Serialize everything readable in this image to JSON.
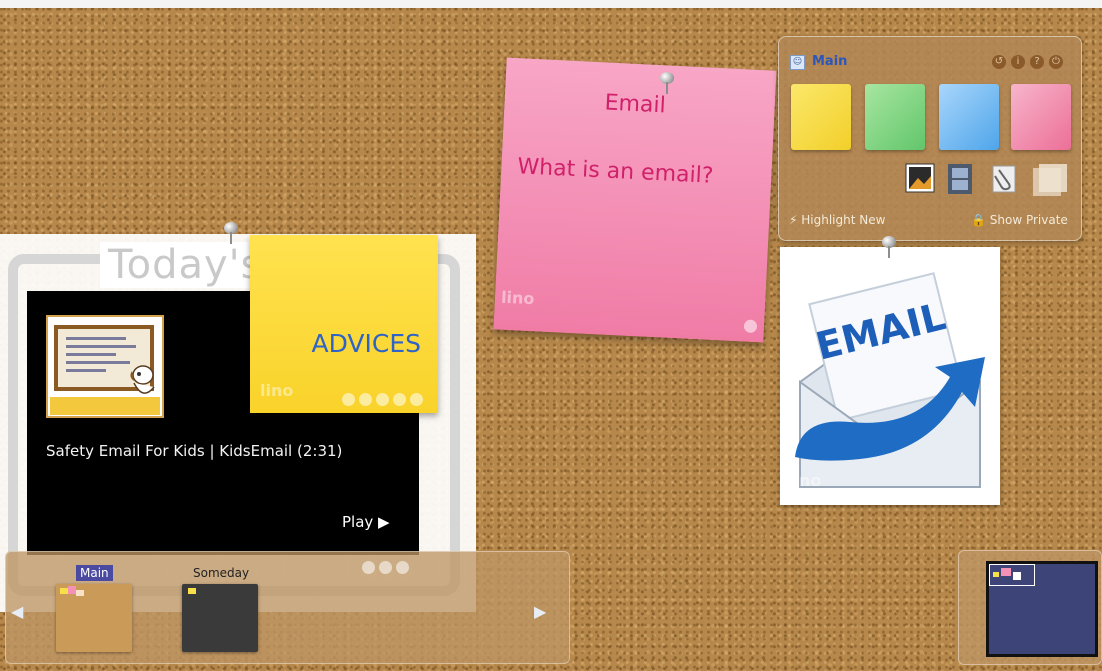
{
  "today_panel": {
    "title": "Today's"
  },
  "video": {
    "title": "Safety Email For Kids | KidsEmail (2:31)",
    "play_label": "Play ▶"
  },
  "notes": {
    "yellow": {
      "text": "ADVICES",
      "color": "#f9d32a"
    },
    "pink": {
      "title": "Email",
      "body": "What is an email?",
      "color": "#f391b6"
    },
    "watermark": "lino"
  },
  "main_panel": {
    "title": "Main",
    "swatch_colors": [
      "#f7df4a",
      "#7fd37e",
      "#6bb5ee",
      "#ef7fa3"
    ],
    "highlight_label": "Highlight New",
    "private_label": "Show Private"
  },
  "image_note": {
    "text": "EMAIL",
    "colors": {
      "text": "#1d5fb8",
      "arrow": "#1f6cc4"
    }
  },
  "boards": {
    "items": [
      {
        "label": "Main",
        "selected": true
      },
      {
        "label": "Someday",
        "selected": false
      }
    ]
  },
  "colors": {
    "cork": "#b7884b",
    "accent_blue": "#2c56b9"
  }
}
